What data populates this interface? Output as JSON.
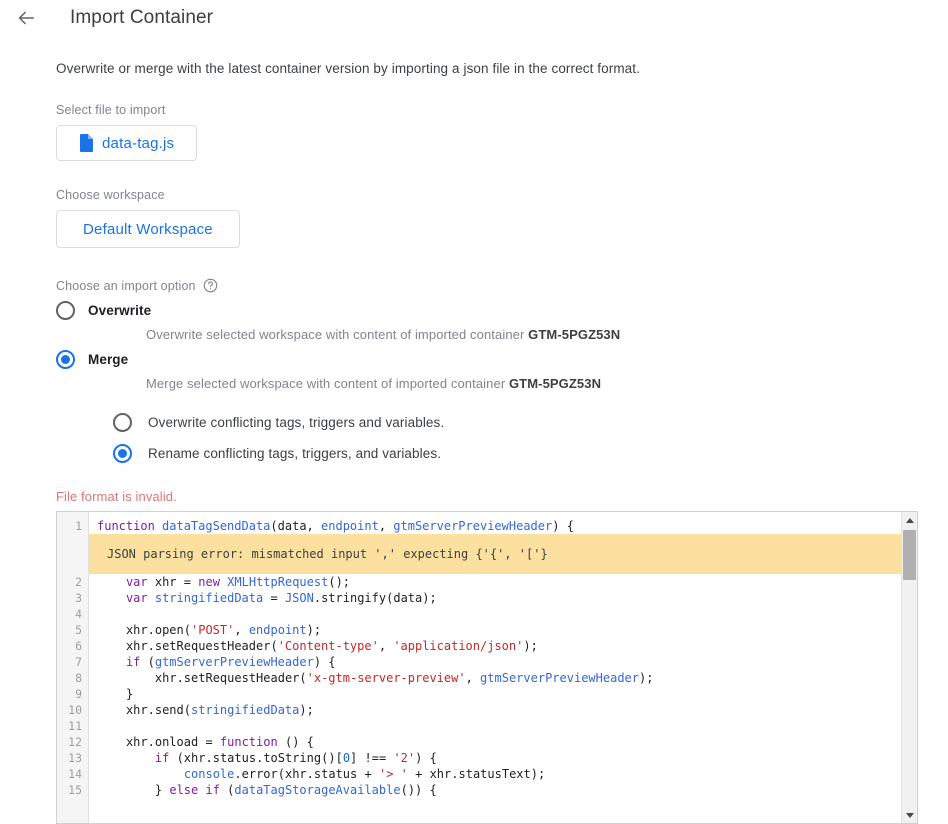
{
  "header": {
    "back_label": "back-arrow",
    "title": "Import Container"
  },
  "intro": "Overwrite or merge with the latest container version by importing a json file in the correct format.",
  "file_section": {
    "label": "Select file to import",
    "file_name": "data-tag.js"
  },
  "workspace_section": {
    "label": "Choose workspace",
    "workspace_name": "Default Workspace"
  },
  "import_option": {
    "label": "Choose an import option",
    "help_icon": "help-circle-icon",
    "options": [
      {
        "title": "Overwrite",
        "checked": false,
        "desc_prefix": "Overwrite selected workspace with content of imported container ",
        "container_id": "GTM-5PGZ53N"
      },
      {
        "title": "Merge",
        "checked": true,
        "desc_prefix": "Merge selected workspace with content of imported container ",
        "container_id": "GTM-5PGZ53N"
      }
    ],
    "sub_options": [
      {
        "label": "Overwrite conflicting tags, triggers and variables.",
        "checked": false
      },
      {
        "label": "Rename conflicting tags, triggers, and variables.",
        "checked": true
      }
    ]
  },
  "editor": {
    "error_text": "File format is invalid.",
    "parse_error": "JSON parsing error: mismatched input ',' expecting {'{', '['}",
    "line_numbers": [
      "1",
      "2",
      "3",
      "4",
      "5",
      "6",
      "7",
      "8",
      "9",
      "10",
      "11",
      "12",
      "13",
      "14",
      "15"
    ],
    "lines": [
      "function dataTagSendData(data, endpoint, gtmServerPreviewHeader) {",
      "    var xhr = new XMLHttpRequest();",
      "    var stringifiedData = JSON.stringify(data);",
      "",
      "    xhr.open('POST', endpoint);",
      "    xhr.setRequestHeader('Content-type', 'application/json');",
      "    if (gtmServerPreviewHeader) {",
      "        xhr.setRequestHeader('x-gtm-server-preview', gtmServerPreviewHeader);",
      "    }",
      "    xhr.send(stringifiedData);",
      "",
      "    xhr.onload = function () {",
      "        if (xhr.status.toString()[0] !== '2') {",
      "            console.error(xhr.status + '> ' + xhr.statusText);",
      "        } else if (dataTagStorageAvailable()) {"
    ],
    "scrollbar": {
      "up_arrow": "scroll-up-arrow",
      "down_arrow": "scroll-down-arrow"
    }
  },
  "colors": {
    "accent": "#1a73e8",
    "error": "#e57373",
    "highlight": "#fbe0a0",
    "label": "#80868b"
  }
}
